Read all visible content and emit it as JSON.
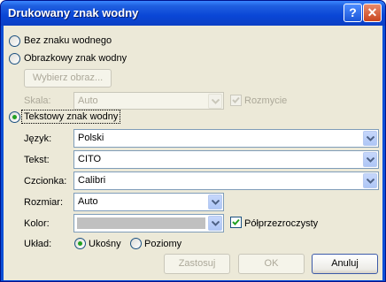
{
  "window": {
    "title": "Drukowany znak wodny",
    "help_glyph": "?",
    "close_glyph": "✕"
  },
  "options": {
    "none_label": "Bez znaku wodnego",
    "picture_label": "Obrazkowy znak wodny",
    "select_picture_label": "Wybierz obraz...",
    "scale_label": "Skala:",
    "scale_value": "Auto",
    "washout_label": "Rozmycie",
    "text_label": "Tekstowy znak wodny"
  },
  "text_watermark": {
    "language_label": "Język:",
    "language_value": "Polski",
    "text_label": "Tekst:",
    "text_value": "CITO",
    "font_label": "Czcionka:",
    "font_value": "Calibri",
    "size_label": "Rozmiar:",
    "size_value": "Auto",
    "color_label": "Kolor:",
    "color_value": "#c0c0c0",
    "semitransparent_label": "Półprzezroczysty",
    "semitransparent_checked": true,
    "layout_label": "Układ:",
    "layout_diagonal": "Ukośny",
    "layout_horizontal": "Poziomy",
    "layout_selected": "Ukośny"
  },
  "selected_option": "text",
  "buttons": {
    "apply": "Zastosuj",
    "ok": "OK",
    "cancel": "Anuluj"
  },
  "icons": {
    "dropdown": "chevron-down-icon",
    "check": "checkmark-icon"
  }
}
